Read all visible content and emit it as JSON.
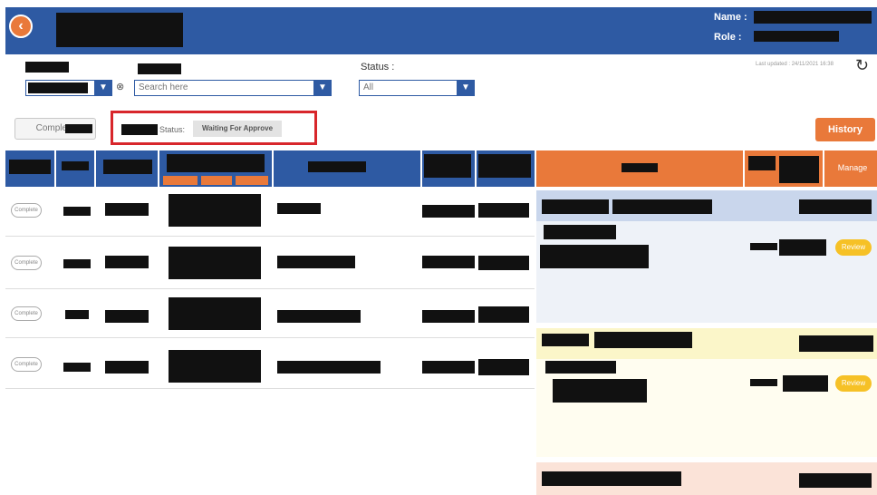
{
  "header": {
    "back_icon": "back-arrow-icon",
    "name_label": "Name :",
    "role_label": "Role :"
  },
  "filters": {
    "status_label": "Status :",
    "status_value": "All",
    "search_placeholder": "Search here",
    "last_updated": "Last updated : 24/11/2021 16:38"
  },
  "toolbar": {
    "complete_label": "Complete",
    "status_text": "Status:",
    "status_value": "Waiting For Approve",
    "history_label": "History"
  },
  "table": {
    "manage_header": "Manage",
    "rows": [
      {
        "status": "Complete",
        "review": ""
      },
      {
        "status": "Complete",
        "review": "Review"
      },
      {
        "status": "Complete",
        "review": ""
      },
      {
        "status": "Complete",
        "review": "Review"
      }
    ]
  },
  "colors": {
    "primary": "#2e5aa3",
    "accent": "#e9793a",
    "alert": "#d8262b",
    "review": "#f6c126"
  }
}
